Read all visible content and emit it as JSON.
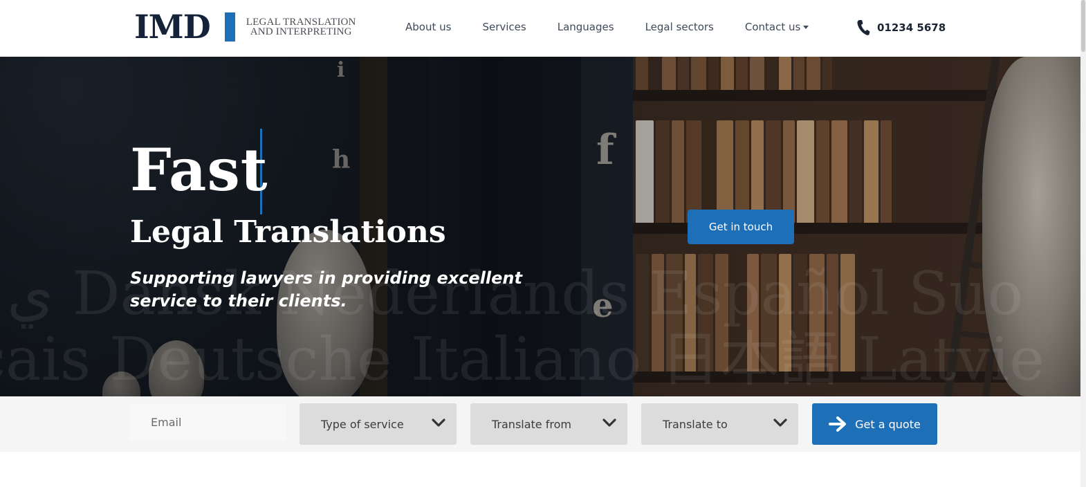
{
  "header": {
    "logo_mark": "IMD",
    "logo_line1": "LEGAL TRANSLATION",
    "logo_line2": "AND INTERPRETING",
    "nav": [
      {
        "label": "About us"
      },
      {
        "label": "Services"
      },
      {
        "label": "Languages"
      },
      {
        "label": "Legal sectors"
      },
      {
        "label": "Contact us",
        "has_dropdown": true
      }
    ],
    "phone": "01234 5678",
    "phone_icon": "phone-icon"
  },
  "hero": {
    "title": "Fast",
    "subtitle": "Legal Translations",
    "tagline": "Supporting lawyers in providing excellent service to their clients.",
    "cta_label": "Get in touch",
    "watermark_line1": "ي Dansk Nederlands Español Suo",
    "watermark_line2": "çais Deutsche Italiano 日本語 Latvie",
    "shelf_letters": [
      "i",
      "h",
      "f",
      "e"
    ]
  },
  "quote_form": {
    "email_placeholder": "Email",
    "service_select": "Type of service",
    "from_select": "Translate from",
    "to_select": "Translate to",
    "submit_label": "Get a quote",
    "submit_icon": "arrow-right-icon"
  },
  "colors": {
    "accent": "#1d6fb8",
    "navy": "#14233a",
    "nav_text": "#3f4a5a",
    "select_bg": "#dcdcdc",
    "form_bg": "#f5f5f5"
  }
}
